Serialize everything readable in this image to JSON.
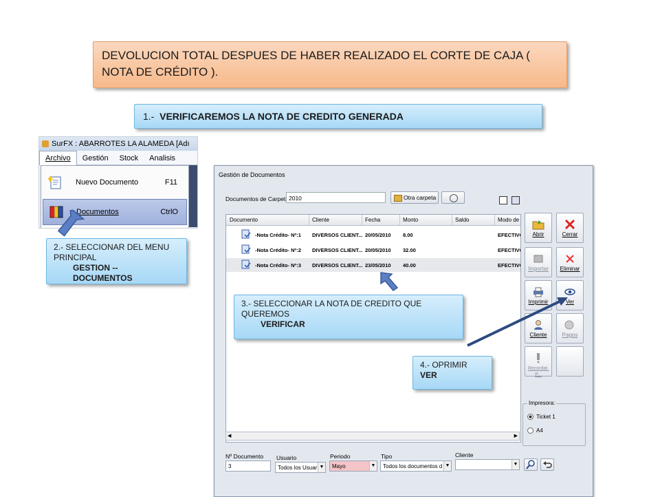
{
  "header": {
    "title": "DEVOLUCION TOTAL DESPUES DE HABER REALIZADO EL CORTE DE CAJA ( NOTA DE CRÉDITO ).",
    "step1_num": "1.-",
    "step1_text": "VERIFICAREMOS LA NOTA DE CREDITO GENERADA"
  },
  "menu_shot": {
    "app_title": "SurFX :  ABARROTES LA ALAMEDA [Adı",
    "menubar": [
      "Archivo",
      "Gestión",
      "Stock",
      "Analisis"
    ],
    "items": [
      {
        "label": "Nuevo Documento",
        "shortcut": "F11"
      },
      {
        "label": "Documentos",
        "shortcut": "CtrlO"
      }
    ]
  },
  "callouts": {
    "step2_text": "2.-  SELECCIONAR DEL MENU PRINCIPAL",
    "step2_bold": "GESTION -- DOCUMENTOS",
    "step3_text": "3.-  SELECCIONAR  LA NOTA DE CREDITO QUE QUEREMOS",
    "step3_bold": "VERIFICAR",
    "step4_text": "4.-  OPRIMIR",
    "step4_bold": "VER"
  },
  "window": {
    "title": "Gestión de Documentos",
    "carpeta_label": "Documentos de Carpeta",
    "carpeta_value": "2010",
    "otra_carpeta": "Otra carpeta",
    "columns": [
      "Documento",
      "Cliente",
      "Fecha",
      "Monto",
      "Saldo",
      "Modo de"
    ],
    "rows": [
      {
        "doc": "-Nota Crédito- Nº:1",
        "cliente": "DIVERSOS CLIENT...",
        "fecha": "20/05/2010",
        "monto": "8.00",
        "modo": "EFECTIVO"
      },
      {
        "doc": "-Nota Crédito- Nº:2",
        "cliente": "DIVERSOS CLIENT...",
        "fecha": "20/05/2010",
        "monto": "32.00",
        "modo": "EFECTIVO"
      },
      {
        "doc": "-Nota Crédito- Nº:3",
        "cliente": "DIVERSOS CLIENT...",
        "fecha": "23/05/2010",
        "monto": "40.00",
        "modo": "EFECTIVO"
      }
    ],
    "buttons": {
      "abrir": "Abrir",
      "cerrar": "Cerrar",
      "importar": "Importar",
      "eliminar": "Eliminar",
      "imprimir": "Imprimir",
      "ver": "Ver",
      "cliente": "Cliente",
      "pagos": "Pagos",
      "recordat": "Recordat. P..."
    },
    "impresora": {
      "label": "Impresora:",
      "opt1": "Ticket 1",
      "opt2": "A4"
    },
    "filters": {
      "num_label": "Nº Documento",
      "num_value": "3",
      "usuario_label": "Usuario",
      "usuario_value": "Todos los Usuar",
      "periodo_label": "Periodo",
      "periodo_value": "Mayo",
      "tipo_label": "Tipo",
      "tipo_value": "Todos los documentos d",
      "cliente_label": "Cliente",
      "cliente_value": ""
    }
  }
}
